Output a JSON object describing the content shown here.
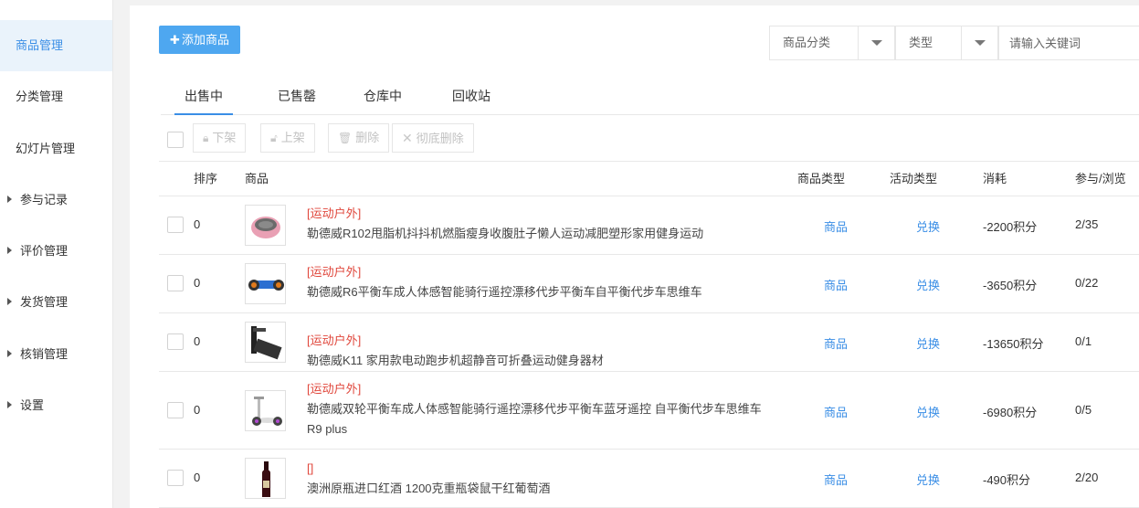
{
  "sidebar": {
    "items": [
      {
        "label": "商品管理",
        "active": true,
        "caret": false
      },
      {
        "label": "分类管理",
        "active": false,
        "caret": false
      },
      {
        "label": "幻灯片管理",
        "active": false,
        "caret": false
      },
      {
        "label": "参与记录",
        "active": false,
        "caret": true
      },
      {
        "label": "评价管理",
        "active": false,
        "caret": true
      },
      {
        "label": "发货管理",
        "active": false,
        "caret": true
      },
      {
        "label": "核销管理",
        "active": false,
        "caret": true
      },
      {
        "label": "设置",
        "active": false,
        "caret": true
      }
    ]
  },
  "header": {
    "add_button": "添加商品",
    "category_filter": "商品分类",
    "type_filter": "类型",
    "search_placeholder": "请输入关键词"
  },
  "tabs": [
    "出售中",
    "已售罄",
    "仓库中",
    "回收站"
  ],
  "toolbar": {
    "offshelf": "下架",
    "onshelf": "上架",
    "delete": "删除",
    "purge": "彻底删除"
  },
  "table": {
    "columns": [
      "排序",
      "商品",
      "商品类型",
      "活动类型",
      "消耗",
      "参与/浏览"
    ],
    "rows": [
      {
        "sort": "0",
        "category": "[运动户外]",
        "name": "勒德威R102甩脂机抖抖机燃脂瘦身收腹肚子懒人运动减肥塑形家用健身运动",
        "name2": "",
        "type": "商品",
        "activity": "兑换",
        "cost": "-2200积分",
        "stats": "2/35",
        "image": "massager"
      },
      {
        "sort": "0",
        "category": "[运动户外]",
        "name": "勒德威R6平衡车成人体感智能骑行遥控漂移代步平衡车自平衡代步车思维车",
        "name2": "",
        "type": "商品",
        "activity": "兑换",
        "cost": "-3650积分",
        "stats": "0/22",
        "image": "hoverboard"
      },
      {
        "sort": "0",
        "category": "[运动户外]",
        "name": "勒德威K11 家用款电动跑步机超静音可折叠运动健身器材",
        "name2": "",
        "type": "商品",
        "activity": "兑换",
        "cost": "-13650积分",
        "stats": "0/1",
        "image": "treadmill"
      },
      {
        "sort": "0",
        "category": "[运动户外]",
        "name": "勒德威双轮平衡车成人体感智能骑行遥控漂移代步平衡车蓝牙遥控 自平衡代步车思维车",
        "name2": "R9 plus",
        "type": "商品",
        "activity": "兑换",
        "cost": "-6980积分",
        "stats": "0/5",
        "image": "segway"
      },
      {
        "sort": "0",
        "category": "[]",
        "name": "澳洲原瓶进口红酒 1200克重瓶袋鼠干红葡萄酒",
        "name2": "",
        "type": "商品",
        "activity": "兑换",
        "cost": "-490积分",
        "stats": "2/20",
        "image": "wine"
      }
    ]
  },
  "colors": {
    "accent": "#3a8ee6",
    "button": "#4ea7f0",
    "category_red": "#e0473c",
    "active_bg": "#eaf3fb"
  }
}
